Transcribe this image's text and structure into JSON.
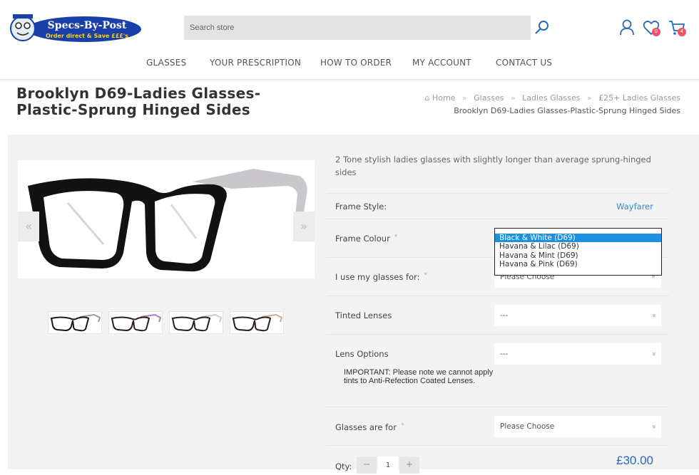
{
  "header": {
    "logo_line1": "Specs-By-Post",
    "logo_line2": "Order direct & Save £££'s",
    "search_placeholder": "Search store",
    "wishlist_count": "0",
    "cart_count": "4"
  },
  "nav": [
    "GLASSES",
    "YOUR PRESCRIPTION",
    "HOW TO ORDER",
    "MY ACCOUNT",
    "CONTACT US"
  ],
  "product": {
    "title": "Brooklyn D69-Ladies Glasses-Plastic-Sprung Hinged Sides",
    "breadcrumb": [
      "Home",
      "Glasses",
      "Ladies Glasses",
      "£25+ Ladies Glasses"
    ],
    "breadcrumb_current": "Brooklyn D69-Ladies Glasses-Plastic-Sprung Hinged Sides",
    "description": "2 Tone stylish ladies glasses with slightly longer than average sprung-hinged sides",
    "frame_style_label": "Frame Style:",
    "frame_style_value": "Wayfarer",
    "frame_colour_label": "Frame Colour",
    "frame_colour_options": [
      "Black & White (D69)",
      "Havana & Lilac (D69)",
      "Havana & Mint (D69)",
      "Havana & Pink (D69)"
    ],
    "use_label": "I use my glasses for:",
    "use_value": "Please Choose",
    "tinted_label": "Tinted Lenses",
    "tinted_value": "---",
    "lens_label": "Lens Options",
    "lens_value": "---",
    "important_note": "IMPORTANT: Please note we cannot apply tints to Anti-Refection Coated Lenses.",
    "glasses_for_label": "Glasses are for",
    "glasses_for_value": "Please Choose",
    "required_mark": "*",
    "qty_label": "Qty:",
    "qty_value": "1",
    "qty_minus": "−",
    "qty_plus": "+",
    "price": "£30.00",
    "prev_arrow": "«",
    "next_arrow": "»",
    "thumb_colors": [
      "#9a9a9a",
      "#a77cc4",
      "#bcd0cf",
      "#d1a99a"
    ]
  },
  "colors": {
    "accent": "#3a86c8",
    "price": "#2a6ab4",
    "badge": "#e95565",
    "dropdown_selected": "#1e90e0"
  }
}
